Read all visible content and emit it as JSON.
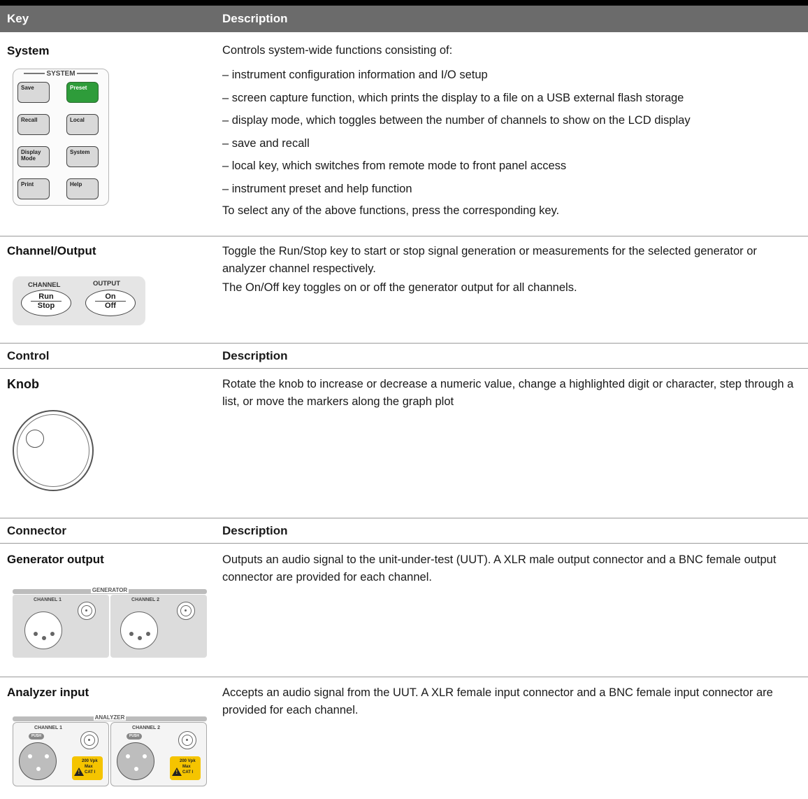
{
  "table_header": {
    "key": "Key",
    "description": "Description"
  },
  "rows": {
    "system": {
      "title": "System",
      "intro": "Controls system-wide functions consisting of:",
      "items": [
        "– instrument configuration information and I/O setup",
        "– screen capture function, which prints the display to a file on a USB external flash storage",
        "– display mode, which toggles between the number of channels to show on the LCD display",
        "– save and recall",
        "– local key, which switches from remote mode to front panel access",
        "– instrument preset and help function"
      ],
      "outro": "To select any of the above functions, press the corresponding key.",
      "panel": {
        "label": "SYSTEM",
        "buttons": {
          "save": "Save",
          "preset": "Preset",
          "recall": "Recall",
          "local": "Local",
          "display_mode": "Display\nMode",
          "system": "System",
          "print": "Print",
          "help": "Help"
        },
        "preset_color": "#2e9c3a"
      }
    },
    "channel_output": {
      "title": "Channel/Output",
      "lines": [
        "Toggle the Run/Stop key to start or stop signal generation or measurements for the selected generator or analyzer channel respectively.",
        "The On/Off key toggles on or off the generator output for all channels."
      ],
      "panel": {
        "channel_label": "CHANNEL",
        "output_label": "OUTPUT",
        "run": "Run",
        "stop": "Stop",
        "on": "On",
        "off": "Off"
      }
    }
  },
  "control_section": {
    "header_key": "Control",
    "header_desc": "Description",
    "knob": {
      "title": "Knob",
      "description": "Rotate the knob to increase or decrease a numeric value, change a highlighted digit or character, step through a list, or move the markers along the graph plot"
    }
  },
  "connector_section": {
    "header_key": "Connector",
    "header_desc": "Description",
    "generator": {
      "title": "Generator output",
      "description": "Outputs an audio signal to the unit-under-test (UUT). A XLR male output connector and a BNC female output connector are provided for each channel.",
      "panel_label": "GENERATOR",
      "ch1": "CHANNEL 1",
      "ch2": "CHANNEL 2"
    },
    "analyzer": {
      "title": "Analyzer input",
      "description": "Accepts an audio signal from the UUT. A XLR female input connector and a BNC female input connector are provided for each channel.",
      "panel_label": "ANALYZER",
      "ch1": "CHANNEL 1",
      "ch2": "CHANNEL 2",
      "push": "PUSH",
      "warn_l1": "200 Vpk",
      "warn_l2": "Max",
      "warn_l3": "CAT I",
      "warn_color": "#f5c400"
    }
  }
}
